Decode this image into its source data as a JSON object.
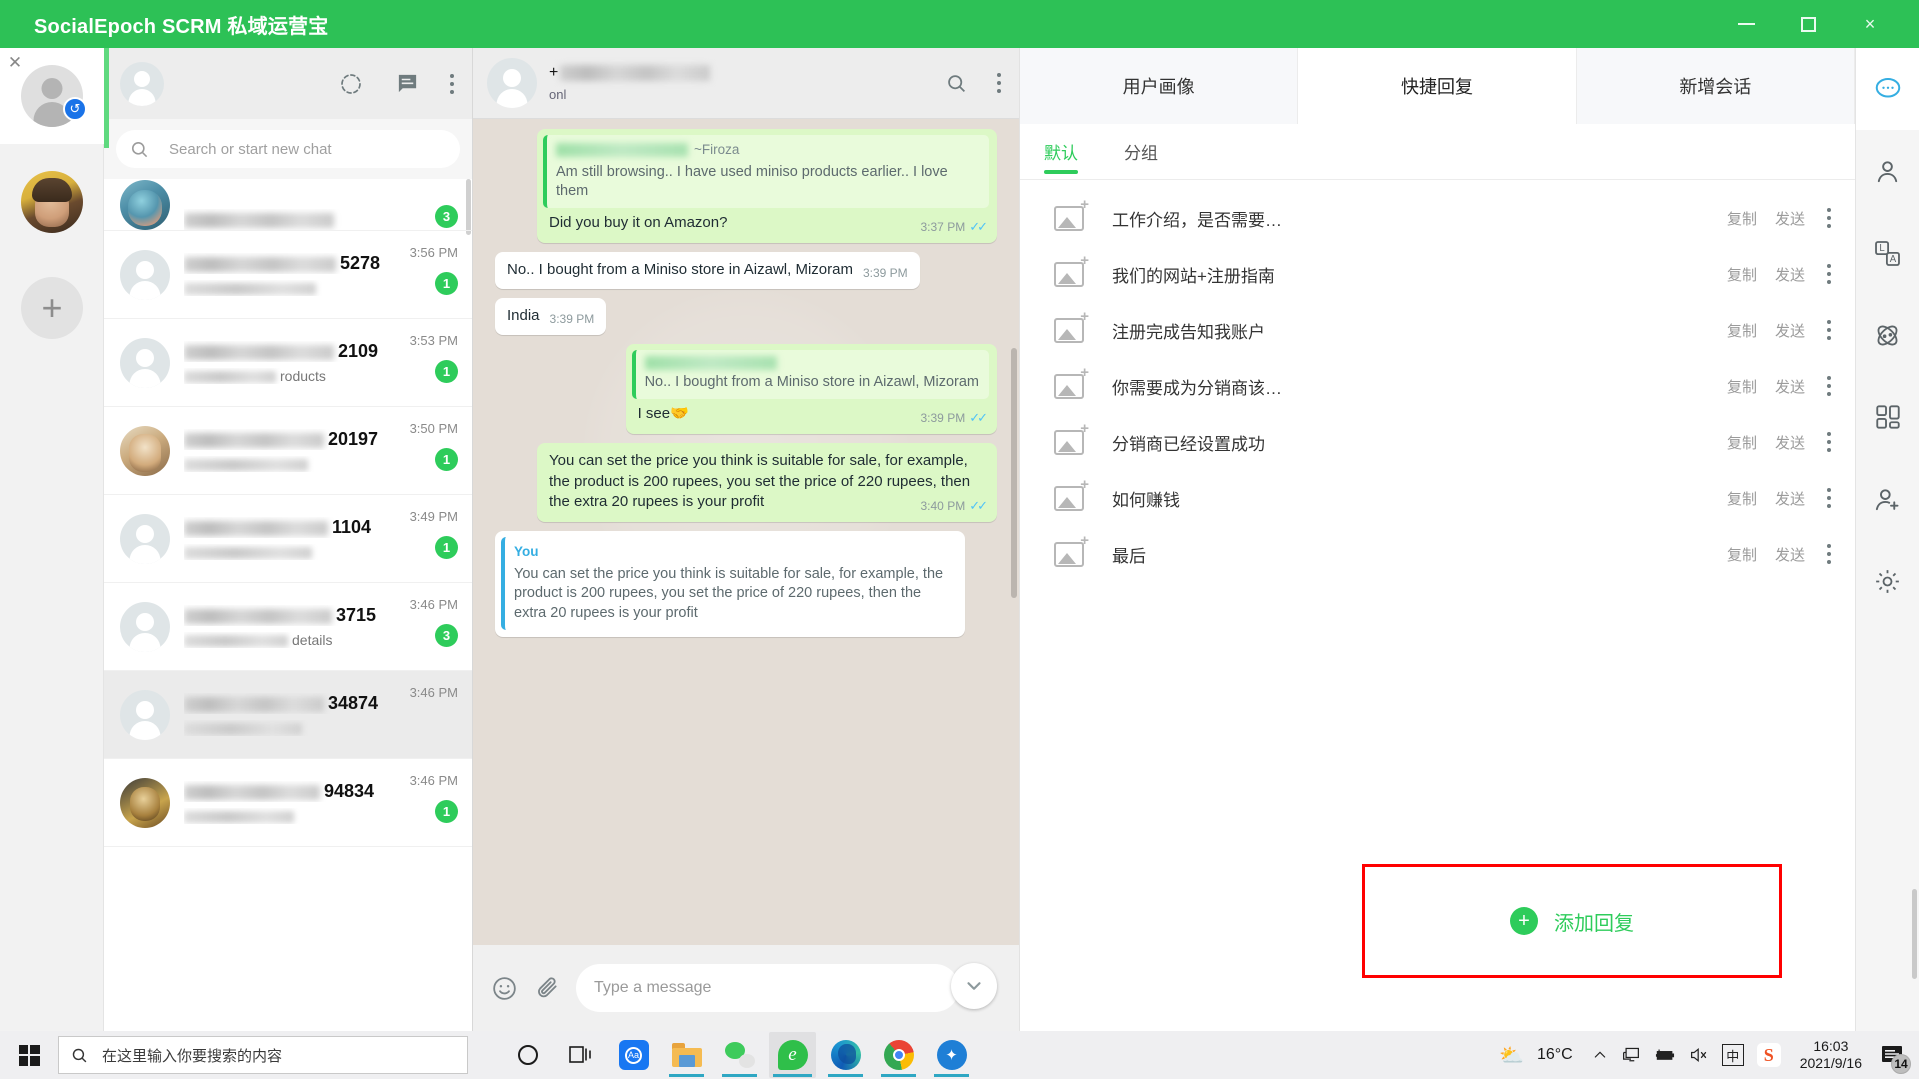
{
  "window": {
    "title": "SocialEpoch SCRM 私域运营宝",
    "minimize_label": "最小化",
    "maximize_label": "最大化",
    "close_label": "×"
  },
  "left_rail": {
    "close_label": "✕",
    "sync_icon": "↺",
    "add_label": "+"
  },
  "chat_list": {
    "search_placeholder": "Search or start new chat",
    "items": [
      {
        "name_visible": "",
        "name_blur_w": 150,
        "sub_visible": "",
        "sub_blur_w": 0,
        "time": "",
        "badge": "3",
        "avatar": "photo-a"
      },
      {
        "name_visible": "5278",
        "name_blur_w": 152,
        "sub_visible": "",
        "sub_blur_w": 132,
        "time": "3:56 PM",
        "badge": "1",
        "avatar": "generic"
      },
      {
        "name_visible": "2109",
        "name_blur_w": 150,
        "sub_visible": "roducts",
        "sub_blur_w": 92,
        "time": "3:53 PM",
        "badge": "1",
        "avatar": "generic"
      },
      {
        "name_visible": "20197",
        "name_blur_w": 140,
        "sub_visible": "",
        "sub_blur_w": 124,
        "time": "3:50 PM",
        "badge": "1",
        "avatar": "photo-b"
      },
      {
        "name_visible": "1104",
        "name_blur_w": 144,
        "sub_visible": "",
        "sub_blur_w": 128,
        "time": "3:49 PM",
        "badge": "1",
        "avatar": "generic"
      },
      {
        "name_visible": "3715",
        "name_blur_w": 148,
        "sub_visible": "details",
        "sub_blur_w": 104,
        "time": "3:46 PM",
        "badge": "3",
        "avatar": "generic"
      },
      {
        "name_visible": "34874",
        "name_blur_w": 140,
        "sub_visible": "",
        "sub_blur_w": 118,
        "time": "3:46 PM",
        "badge": "",
        "avatar": "generic"
      },
      {
        "name_visible": "94834",
        "name_blur_w": 136,
        "sub_visible": "",
        "sub_blur_w": 110,
        "time": "3:46 PM",
        "badge": "1",
        "avatar": "photo-c"
      }
    ]
  },
  "conversation": {
    "contact_phone_prefix": "+",
    "contact_status": "onl",
    "messages": [
      {
        "direction": "out",
        "quote_author": "~Firoza",
        "quote_text": "Am still browsing.. I have used miniso products earlier.. I love them",
        "text": "Did you buy it on Amazon?",
        "time": "3:37 PM",
        "ticks": "✓✓"
      },
      {
        "direction": "in",
        "text": "No.. I bought from a Miniso store in Aizawl, Mizoram",
        "time": "3:39 PM",
        "ticks": ""
      },
      {
        "direction": "in",
        "text": "India",
        "time": "3:39 PM",
        "ticks": ""
      },
      {
        "direction": "out",
        "quote_author": "",
        "quote_text": "No.. I bought from a Miniso store in Aizawl, Mizoram",
        "text": "I see🤝",
        "time": "3:39 PM",
        "ticks": "✓✓"
      },
      {
        "direction": "out",
        "text": "You can set the price you think is suitable for sale, for example, the product is 200 rupees, you set the price of 220 rupees, then the extra 20 rupees is your profit",
        "time": "3:40 PM",
        "ticks": "✓✓"
      },
      {
        "direction": "in",
        "quote_author": "You",
        "quote_text": "You can set the price you think is suitable for sale, for example, the product is 200 rupees, you set the price of 220 rupees, then the extra 20 rupees is your profit",
        "text": "",
        "time": "",
        "ticks": ""
      }
    ],
    "composer_placeholder": "Type a message"
  },
  "right_panel": {
    "tabs": [
      {
        "label": "用户画像",
        "active": false
      },
      {
        "label": "快捷回复",
        "active": true
      },
      {
        "label": "新增会话",
        "active": false
      }
    ],
    "subtabs": [
      {
        "label": "默认",
        "active": true
      },
      {
        "label": "分组",
        "active": false
      }
    ],
    "copy_label": "复制",
    "send_label": "发送",
    "replies": [
      {
        "title": "工作介绍，是否需要…"
      },
      {
        "title": "我们的网站+注册指南"
      },
      {
        "title": "注册完成告知我账户"
      },
      {
        "title": "你需要成为分销商该…"
      },
      {
        "title": "分销商已经设置成功"
      },
      {
        "title": "如何赚钱"
      },
      {
        "title": "最后"
      }
    ],
    "add_reply_label": "添加回复",
    "add_reply_plus": "+",
    "highlight_color": "#ff0000",
    "accent_color": "#2ecc5b"
  },
  "icon_rail": {
    "items": [
      {
        "name": "chat-bubble-icon",
        "active": true
      },
      {
        "name": "contact-icon",
        "active": false
      },
      {
        "name": "translate-icon",
        "active": false
      },
      {
        "name": "plugin-icon",
        "active": false
      },
      {
        "name": "apps-grid-icon",
        "active": false
      },
      {
        "name": "add-contact-icon",
        "active": false
      },
      {
        "name": "settings-gear-icon",
        "active": false
      }
    ]
  },
  "taskbar": {
    "search_placeholder": "在这里输入你要搜索的内容",
    "apps": [
      {
        "name": "cortana-icon",
        "running": false,
        "active": false
      },
      {
        "name": "task-view-icon",
        "running": false,
        "active": false
      },
      {
        "name": "translate-app-icon",
        "running": false,
        "active": false
      },
      {
        "name": "file-explorer-icon",
        "running": true,
        "active": false
      },
      {
        "name": "wechat-icon",
        "running": true,
        "active": false
      },
      {
        "name": "scrm-app-icon",
        "running": true,
        "active": true
      },
      {
        "name": "edge-icon",
        "running": true,
        "active": false
      },
      {
        "name": "chrome-icon",
        "running": true,
        "active": false
      },
      {
        "name": "blue-app-icon",
        "running": true,
        "active": false
      }
    ],
    "tray": {
      "weather_icon": "⛅",
      "temperature": "16°C",
      "chevron": "⌃",
      "network_icon": "network-icon",
      "battery_icon": "battery-icon",
      "volume_icon": "volume-muted-icon",
      "ime_label": "中",
      "sogou_label": "S",
      "time": "16:03",
      "date": "2021/9/16",
      "notification_count": "14"
    }
  }
}
